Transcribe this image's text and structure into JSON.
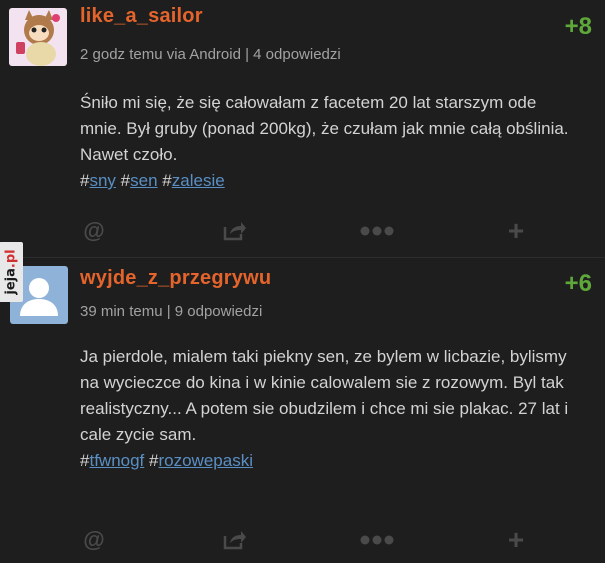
{
  "posts": [
    {
      "username": "like_a_sailor",
      "meta": "2 godz temu via Android | 4 odpowiedzi",
      "vote": "+8",
      "body_line": "Śniło mi się, że się całowałam z facetem 20 lat starszym ode mnie. Był gruby (ponad 200kg), że czułam jak mnie całą obślinia. Nawet czoło.",
      "tags": [
        "sny",
        "sen",
        "zalesie"
      ],
      "avatar_icon": "cartoon-cat-avatar"
    },
    {
      "username": "wyjde_z_przegrywu",
      "meta": "39 min temu | 9 odpowiedzi",
      "vote": "+6",
      "body_line": "Ja pierdole, mialem taki piekny sen, ze bylem w licbazie, bylismy na wycieczce do kina i w kinie calowalem sie z rozowym. Byl tak realistyczny... A potem sie obudzilem i chce mi sie plakac. 27 lat i cale zycie sam.",
      "tags": [
        "tfwnogf",
        "rozowepaski"
      ],
      "avatar_icon": "default-user-avatar"
    }
  ],
  "actions": {
    "mention_icon": "at-icon",
    "mention_glyph": "@",
    "share_icon": "share-icon",
    "more_icon": "more-dots-icon",
    "plus_icon": "plus-icon",
    "plus_glyph": "+"
  },
  "watermark": {
    "name": "jeja",
    "suffix": ".pl"
  },
  "colors": {
    "background": "#1e1e1e",
    "username": "#e4642b",
    "vote": "#5ea83a",
    "tag": "#5a8fc4",
    "meta": "#a2a2a2",
    "body": "#d3d3d3"
  }
}
